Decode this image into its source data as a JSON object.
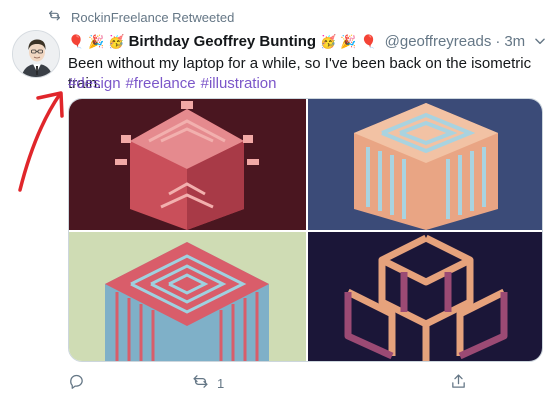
{
  "retweet": {
    "text": "RockinFreelance Retweeted",
    "icon": "retweet-icon"
  },
  "author": {
    "display_name": "Birthday Geoffrey Bunting",
    "handle": "@geoffreyreads",
    "separator": "·",
    "time": "3m",
    "emojis_left": [
      "🎈",
      "🎉",
      "🥳"
    ],
    "emojis_right": [
      "🥳",
      "🎉",
      "🎈"
    ]
  },
  "tweet": {
    "text": "Been without my laptop for a while, so I've been back on the isometric train.",
    "hashtags": [
      "#design",
      "#freelance",
      "#illustration"
    ]
  },
  "media": {
    "images": [
      {
        "name": "isometric-art-red",
        "background": "#4a1620",
        "accent": "#e07c80"
      },
      {
        "name": "isometric-art-blue",
        "background": "#3b4b78",
        "accent": "#e9a584"
      },
      {
        "name": "isometric-art-green",
        "background": "#cfdcb4",
        "accent": "#d95d6a"
      },
      {
        "name": "isometric-art-navy",
        "background": "#1b1638",
        "accent": "#e6a27c"
      }
    ]
  },
  "actions": {
    "reply_icon": "reply-icon",
    "retweet_icon": "retweet-icon",
    "retweet_count": "1",
    "share_icon": "share-icon"
  },
  "colors": {
    "hashtag": "#7b56c9",
    "muted": "#657786",
    "annotation_arrow": "#e0262b"
  }
}
